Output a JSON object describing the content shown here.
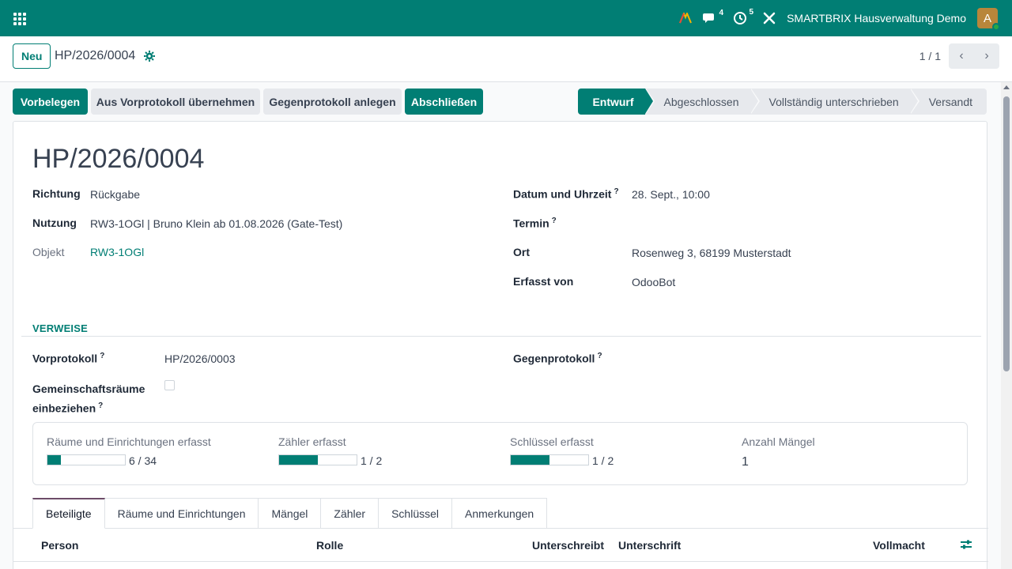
{
  "navbar": {
    "company": "SMARTBRIX Hausverwaltung Demo",
    "chat_count": "4",
    "activity_count": "5",
    "avatar_initial": "A"
  },
  "control": {
    "new_label": "Neu",
    "breadcrumb": "HP/2026/0004",
    "pager": "1 / 1"
  },
  "actions": {
    "vorbelegen": "Vorbelegen",
    "aus_vorprotokoll": "Aus Vorprotokoll übernehmen",
    "gegenprotokoll": "Gegenprotokoll anlegen",
    "abschliessen": "Abschließen"
  },
  "stages": [
    "Entwurf",
    "Abgeschlossen",
    "Vollständig unterschrieben",
    "Versandt"
  ],
  "record": {
    "title": "HP/2026/0004",
    "richtung_label": "Richtung",
    "richtung": "Rückgabe",
    "nutzung_label": "Nutzung",
    "nutzung": "RW3-1OGl | Bruno Klein ab 01.08.2026 (Gate-Test)",
    "objekt_label": "Objekt",
    "objekt": "RW3-1OGl",
    "datum_label": "Datum und Uhrzeit",
    "datum": "28. Sept., 10:00",
    "termin_label": "Termin",
    "ort_label": "Ort",
    "ort": "Rosenweg 3, 68199 Musterstadt",
    "erfasst_label": "Erfasst von",
    "erfasst": "OdooBot"
  },
  "verweise": {
    "heading": "VERWEISE",
    "vorprotokoll_label": "Vorprotokoll",
    "vorprotokoll": "HP/2026/0003",
    "gegenprotokoll_label": "Gegenprotokoll",
    "gemeinschaft_label_1": "Gemeinschaftsräume",
    "gemeinschaft_label_2": "einbeziehen",
    "help_mark": "?"
  },
  "stats": {
    "raeume_label": "Räume und Einrichtungen erfasst",
    "raeume_value": "6 / 34",
    "raeume_progress": 0.176,
    "zaehler_label": "Zähler erfasst",
    "zaehler_value": "1 / 2",
    "zaehler_progress": 0.5,
    "schluessel_label": "Schlüssel erfasst",
    "schluessel_value": "1 / 2",
    "schluessel_progress": 0.5,
    "maengel_label": "Anzahl Mängel",
    "maengel_value": "1"
  },
  "tabs": [
    "Beteiligte",
    "Räume und Einrichtungen",
    "Mängel",
    "Zähler",
    "Schlüssel",
    "Anmerkungen"
  ],
  "table": {
    "person": "Person",
    "rolle": "Rolle",
    "unterschreibt": "Unterschreibt",
    "unterschrift": "Unterschrift",
    "vollmacht": "Vollmacht"
  },
  "colors": {
    "primary": "#017e74",
    "active_tab": "#6c4c68"
  }
}
